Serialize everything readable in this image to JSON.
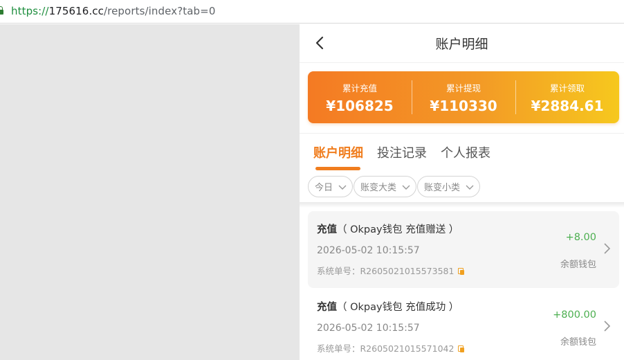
{
  "browser": {
    "url_scheme": "https://",
    "url_host": "175616.cc",
    "url_path": "/reports/index?tab=0"
  },
  "header": {
    "title": "账户明细"
  },
  "summary": {
    "stats": [
      {
        "label": "累计充值",
        "value": "¥106825"
      },
      {
        "label": "累计提现",
        "value": "¥110330"
      },
      {
        "label": "累计领取",
        "value": "¥2884.61"
      }
    ]
  },
  "tabs": [
    {
      "label": "账户明细",
      "active": true
    },
    {
      "label": "投注记录",
      "active": false
    },
    {
      "label": "个人报表",
      "active": false
    }
  ],
  "filters": [
    {
      "label": "今日"
    },
    {
      "label": "账变大类"
    },
    {
      "label": "账变小类"
    }
  ],
  "records": [
    {
      "kind": "充值",
      "detail": "（ Okpay钱包 充值赠送 ）",
      "time": "2026-05-02 10:15:57",
      "order": "系统单号：R2605021015573581",
      "amount": "+8.00",
      "wallet": "余额钱包"
    },
    {
      "kind": "充值",
      "detail": "（ Okpay钱包 充值成功 ）",
      "time": "2026-05-02 10:15:57",
      "order": "系统单号：R2605021015571042",
      "amount": "+800.00",
      "wallet": "余额钱包"
    }
  ],
  "colors": {
    "accent": "#f07d1e",
    "positive": "#4caf50",
    "copy_icon": "#f0a020"
  }
}
